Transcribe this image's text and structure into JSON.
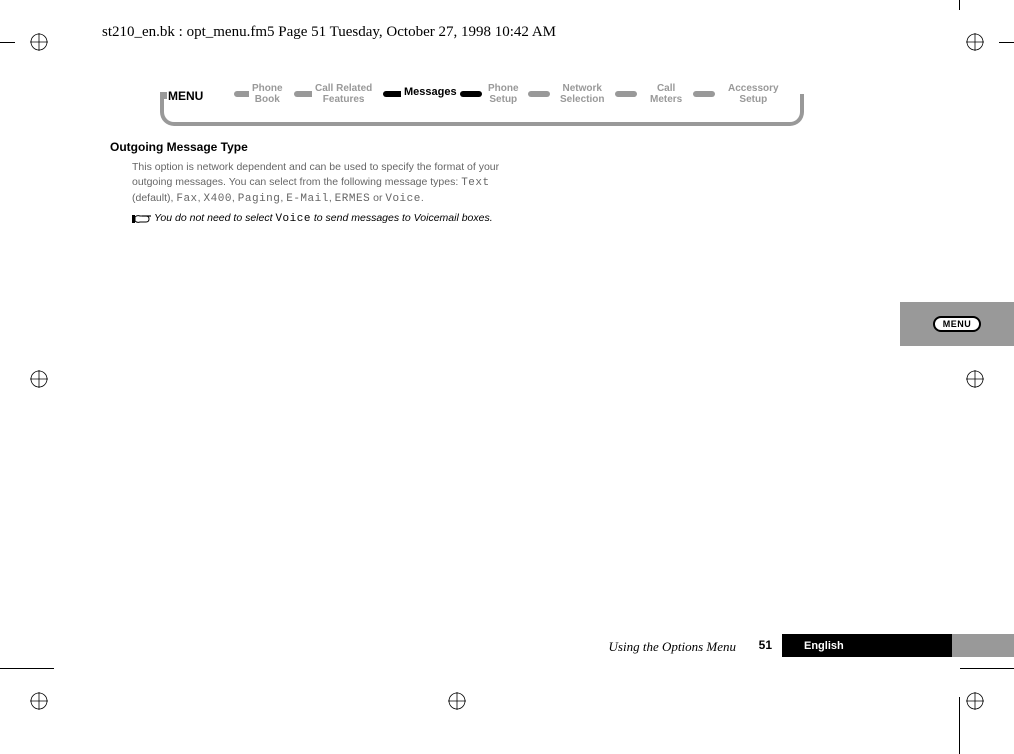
{
  "header": "st210_en.bk : opt_menu.fm5  Page 51  Tuesday, October 27, 1998  10:42 AM",
  "menu": {
    "label": "MENU",
    "items": [
      {
        "line1": "Phone",
        "line2": "Book"
      },
      {
        "line1": "Call Related",
        "line2": "Features"
      },
      {
        "line1": "Messages",
        "line2": ""
      },
      {
        "line1": "Phone",
        "line2": "Setup"
      },
      {
        "line1": "Network",
        "line2": "Selection"
      },
      {
        "line1": "Call",
        "line2": "Meters"
      },
      {
        "line1": "Accessory",
        "line2": "Setup"
      }
    ]
  },
  "section": {
    "heading": "Outgoing Message Type",
    "para1_a": "This option is network dependent and can be used to specify the format of your outgoing messages. You can select from the following message types: ",
    "type_text": "Text",
    "default_label": " (default), ",
    "type_fax": "Fax",
    "sep": ", ",
    "type_x400": "X400",
    "type_paging": "Paging",
    "type_email": "E-Mail",
    "type_ermes": "ERMES",
    "or": " or ",
    "type_voice": "Voice",
    "period": ".",
    "note_a": "You do not need to select ",
    "note_code": "Voice",
    "note_b": " to send messages to Voicemail boxes."
  },
  "sidetab": "MENU",
  "footer": {
    "chapter": "Using the Options Menu",
    "page": "51",
    "language": "English"
  }
}
